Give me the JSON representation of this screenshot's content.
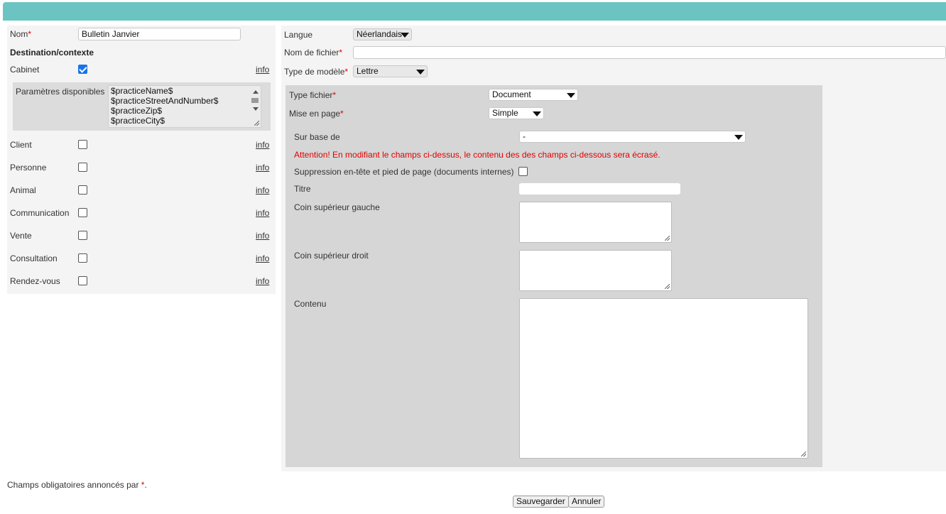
{
  "left": {
    "nom_label": "Nom",
    "nom_value": "Bulletin Janvier",
    "destination_heading": "Destination/contexte",
    "params_label": "Paramètres disponibles",
    "params": [
      "$practiceName$",
      "$practiceStreetAndNumber$",
      "$practiceZip$",
      "$practiceCity$"
    ],
    "info": "info",
    "contexts": [
      {
        "label": "Cabinet",
        "checked": true
      },
      {
        "label": "Client",
        "checked": false
      },
      {
        "label": "Personne",
        "checked": false
      },
      {
        "label": "Animal",
        "checked": false
      },
      {
        "label": "Communication",
        "checked": false
      },
      {
        "label": "Vente",
        "checked": false
      },
      {
        "label": "Consultation",
        "checked": false
      },
      {
        "label": "Rendez-vous",
        "checked": false
      }
    ]
  },
  "right": {
    "langue_label": "Langue",
    "langue_value": "Néerlandais",
    "nom_fichier_label": "Nom de fichier",
    "nom_fichier_value": "",
    "type_modele_label": "Type de modèle",
    "type_modele_value": "Lettre",
    "type_fichier_label": "Type fichier",
    "type_fichier_value": "Document",
    "mise_en_page_label": "Mise en page",
    "mise_en_page_value": "Simple",
    "sur_base_label": "Sur base de",
    "sur_base_value": "-",
    "warning": "Attention! En modifiant le champs ci-dessus, le contenu des des champs ci-dessous sera écrasé.",
    "suppression_label": "Suppression en-tête et pied de page (documents internes)",
    "titre_label": "Titre",
    "coin_gauche_label": "Coin supérieur gauche",
    "coin_droit_label": "Coin supérieur droit",
    "contenu_label": "Contenu"
  },
  "footer": {
    "note_prefix": "Champs obligatoires annoncés par ",
    "note_star": "*",
    "note_suffix": ".",
    "save_label": "Sauvegarder",
    "cancel_label": "Annuler"
  },
  "required_star": "*",
  "colors": {
    "topbar": "#6cc4c2",
    "required": "#e00000",
    "checkbox": "#1a73e8"
  }
}
